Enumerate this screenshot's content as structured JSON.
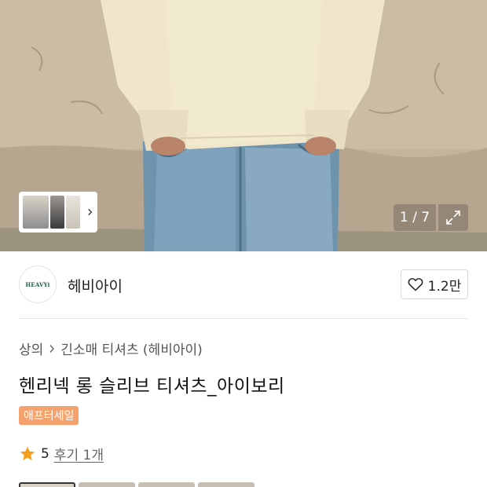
{
  "gallery": {
    "current": "1",
    "total": "7",
    "counter": "1 / 7",
    "icons": [
      "thumbnail-next-chevron-icon",
      "expand-icon"
    ]
  },
  "brand": {
    "logo_text": "HEAVYi",
    "name": "헤비아이",
    "like_count": "1.2만"
  },
  "breadcrumb": {
    "category": "상의",
    "subcategory": "긴소매 티셔츠 (헤비아이)"
  },
  "product": {
    "title": "헨리넥 롱 슬리브 티셔츠_아이보리",
    "badge": "애프터세일",
    "badge_color": "#f5a36e"
  },
  "rating": {
    "score": "5",
    "reviews": "후기 1개",
    "star_color": "#f59e1b"
  }
}
